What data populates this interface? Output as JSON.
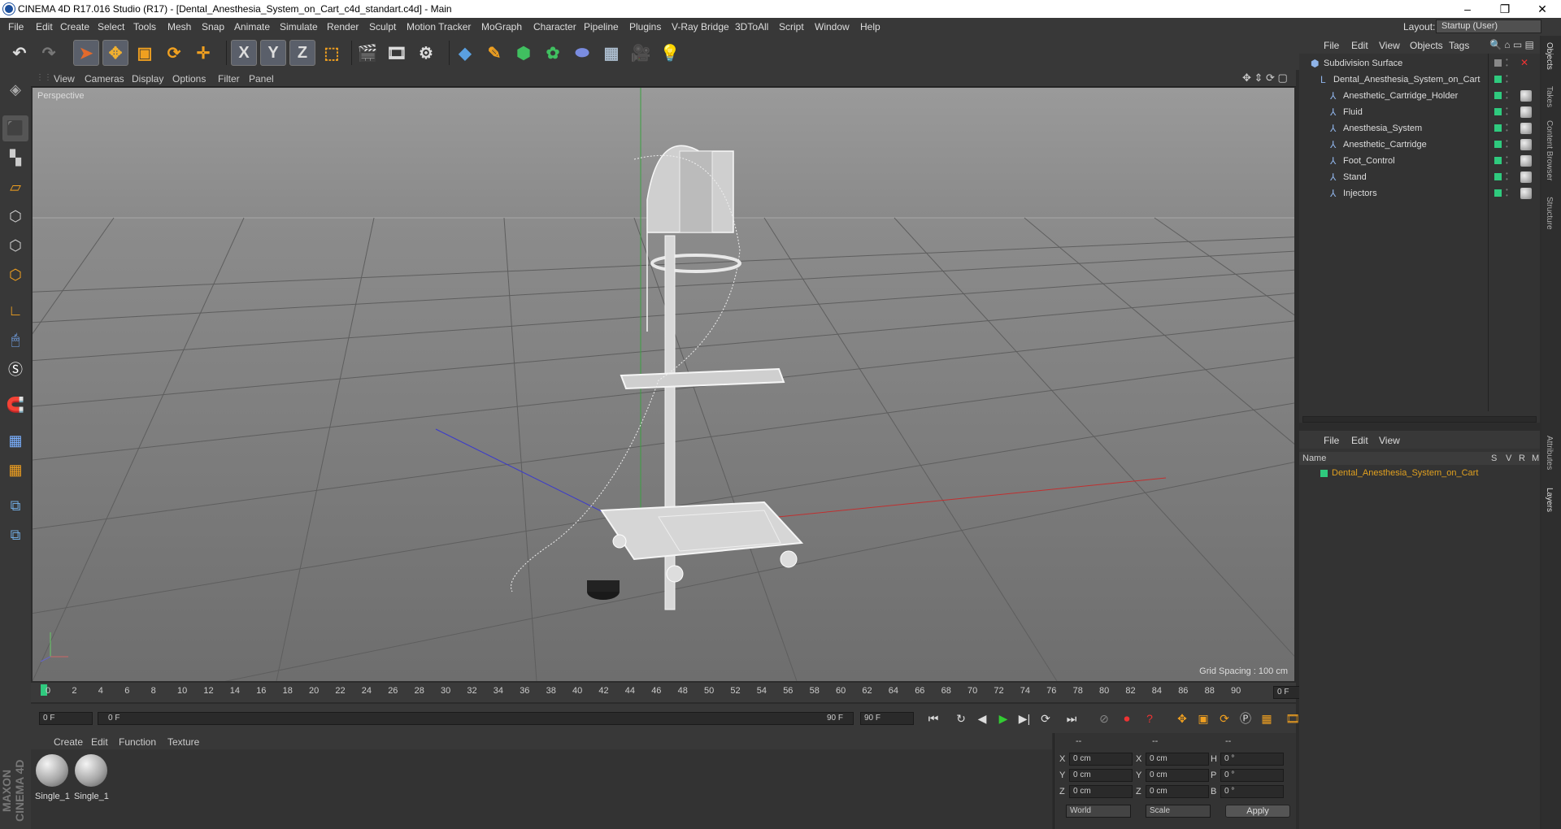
{
  "window": {
    "title": "CINEMA 4D R17.016 Studio (R17) - [Dental_Anesthesia_System_on_Cart_c4d_standart.c4d] - Main",
    "controls": [
      "–",
      "❐",
      "✕"
    ]
  },
  "menubar": {
    "items": [
      "File",
      "Edit",
      "Create",
      "Select",
      "Tools",
      "Mesh",
      "Snap",
      "Animate",
      "Simulate",
      "Render",
      "Sculpt",
      "Motion Tracker",
      "MoGraph",
      "Character",
      "Pipeline",
      "Plugins",
      "V-Ray Bridge",
      "3DToAll",
      "Script",
      "Window",
      "Help"
    ],
    "layout_label": "Layout:",
    "layout_value": "Startup (User)"
  },
  "toolbar": {
    "axis_x": "X",
    "axis_y": "Y",
    "axis_z": "Z"
  },
  "viewport": {
    "menu": [
      "View",
      "Cameras",
      "Display",
      "Options",
      "Filter",
      "Panel"
    ],
    "label": "Perspective",
    "grid_spacing": "Grid Spacing : 100 cm"
  },
  "timeline": {
    "ticks": [
      "0",
      "2",
      "4",
      "6",
      "8",
      "10",
      "12",
      "14",
      "16",
      "18",
      "20",
      "22",
      "24",
      "26",
      "28",
      "30",
      "32",
      "34",
      "36",
      "38",
      "40",
      "42",
      "44",
      "46",
      "48",
      "50",
      "52",
      "54",
      "56",
      "58",
      "60",
      "62",
      "64",
      "66",
      "68",
      "70",
      "72",
      "74",
      "76",
      "78",
      "80",
      "82",
      "84",
      "86",
      "88",
      "90"
    ],
    "current_frame": "0 F"
  },
  "transport": {
    "start": "0 F",
    "slider_start": "0 F",
    "slider_end": "90 F",
    "end": "90 F"
  },
  "materials": {
    "menu": [
      "Create",
      "Edit",
      "Function",
      "Texture"
    ],
    "items": [
      "Single_1",
      "Single_1"
    ]
  },
  "coords": {
    "headers": [
      "--",
      "--",
      "--"
    ],
    "rows": [
      {
        "a": "X",
        "av": "0 cm",
        "b": "X",
        "bv": "0 cm",
        "c": "H",
        "cv": "0 °"
      },
      {
        "a": "Y",
        "av": "0 cm",
        "b": "Y",
        "bv": "0 cm",
        "c": "P",
        "cv": "0 °"
      },
      {
        "a": "Z",
        "av": "0 cm",
        "b": "Z",
        "bv": "0 cm",
        "c": "B",
        "cv": "0 °"
      }
    ],
    "world": "World",
    "scale": "Scale",
    "apply": "Apply"
  },
  "object_manager": {
    "menu": [
      "File",
      "Edit",
      "View",
      "Objects",
      "Tags"
    ],
    "objects": [
      {
        "name": "Subdivision Surface",
        "level": 0
      },
      {
        "name": "Dental_Anesthesia_System_on_Cart",
        "level": 1
      },
      {
        "name": "Anesthetic_Cartridge_Holder",
        "level": 2
      },
      {
        "name": "Fluid",
        "level": 2
      },
      {
        "name": "Anesthesia_System",
        "level": 2
      },
      {
        "name": "Anesthetic_Cartridge",
        "level": 2
      },
      {
        "name": "Foot_Control",
        "level": 2
      },
      {
        "name": "Stand",
        "level": 2
      },
      {
        "name": "Injectors",
        "level": 2
      }
    ]
  },
  "layer_manager": {
    "menu": [
      "File",
      "Edit",
      "View"
    ],
    "columns": [
      "Name",
      "S",
      "V",
      "R",
      "M"
    ],
    "layers": [
      "Dental_Anesthesia_System_on_Cart"
    ]
  },
  "right_tabs": [
    "Objects",
    "Takes",
    "Content Browser",
    "Structure",
    "Attributes",
    "Layers"
  ],
  "brand": "MAXON CINEMA 4D",
  "colors": {
    "accent_green": "#2fca7e",
    "layer_orange": "#e0a020",
    "active_blue": "#5a5f6a"
  }
}
